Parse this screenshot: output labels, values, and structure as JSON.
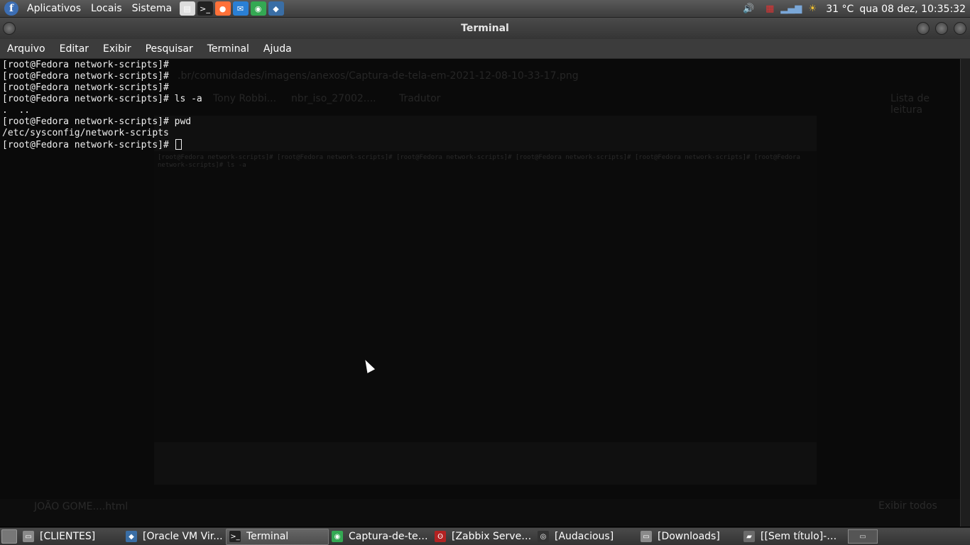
{
  "top_panel": {
    "menus": [
      "Aplicativos",
      "Locais",
      "Sistema"
    ],
    "launchers": [
      {
        "icon": "file-manager-icon",
        "glyph": "▤",
        "bg": "#dcdcdc"
      },
      {
        "icon": "terminal-icon",
        "glyph": ">_",
        "bg": "#222222"
      },
      {
        "icon": "firefox-icon",
        "glyph": "●",
        "bg": "#ff7139"
      },
      {
        "icon": "thunderbird-icon",
        "glyph": "✉",
        "bg": "#2a7fd4"
      },
      {
        "icon": "chrome-icon",
        "glyph": "◉",
        "bg": "#34a853"
      },
      {
        "icon": "virtualbox-icon",
        "glyph": "◆",
        "bg": "#3a6ea5"
      }
    ],
    "weather": "31 °C",
    "clock": "qua 08 dez, 10:35:32"
  },
  "window": {
    "title": "Terminal",
    "menu": [
      "Arquivo",
      "Editar",
      "Exibir",
      "Pesquisar",
      "Terminal",
      "Ajuda"
    ]
  },
  "terminal": {
    "lines": [
      "[root@Fedora network-scripts]#",
      "[root@Fedora network-scripts]#",
      "[root@Fedora network-scripts]#",
      "[root@Fedora network-scripts]# ls -a",
      ".  ..",
      "[root@Fedora network-scripts]# pwd",
      "/etc/sysconfig/network-scripts"
    ],
    "prompt": "[root@Fedora network-scripts]# "
  },
  "background_ghost": {
    "url": ".br/comunidades/imagens/anexos/Captura-de-tela-em-2021-12-08-10-33-17.png",
    "bookmarks": [
      "Tony Robbi...",
      "nbr_iso_27002....",
      "Tradutor"
    ],
    "reading_list": "Lista de leitura",
    "download": "JOÃO GOME....html",
    "show_all": "Exibir todos"
  },
  "taskbar": {
    "tasks": [
      {
        "label": "[CLIENTES]",
        "icon": "folder-icon",
        "glyph": "▭",
        "bg": "#8a8a8a",
        "active": false
      },
      {
        "label": "[Oracle VM Vir...",
        "icon": "virtualbox-icon",
        "glyph": "◆",
        "bg": "#3a6ea5",
        "active": false
      },
      {
        "label": "Terminal",
        "icon": "terminal-icon",
        "glyph": ">_",
        "bg": "#222222",
        "active": true
      },
      {
        "label": "Captura-de-tel...",
        "icon": "chrome-icon",
        "glyph": "◉",
        "bg": "#34a853",
        "active": false
      },
      {
        "label": "[Zabbix Server...",
        "icon": "zabbix-icon",
        "glyph": "ʘ",
        "bg": "#b22222",
        "active": false
      },
      {
        "label": "[Audacious]",
        "icon": "audacious-icon",
        "glyph": "◎",
        "bg": "#333333",
        "active": false
      },
      {
        "label": "[Downloads]",
        "icon": "folder-icon",
        "glyph": "▭",
        "bg": "#8a8a8a",
        "active": false
      },
      {
        "label": "[[Sem título]-1...",
        "icon": "gimp-icon",
        "glyph": "▰",
        "bg": "#6b6b6b",
        "active": false
      }
    ]
  }
}
